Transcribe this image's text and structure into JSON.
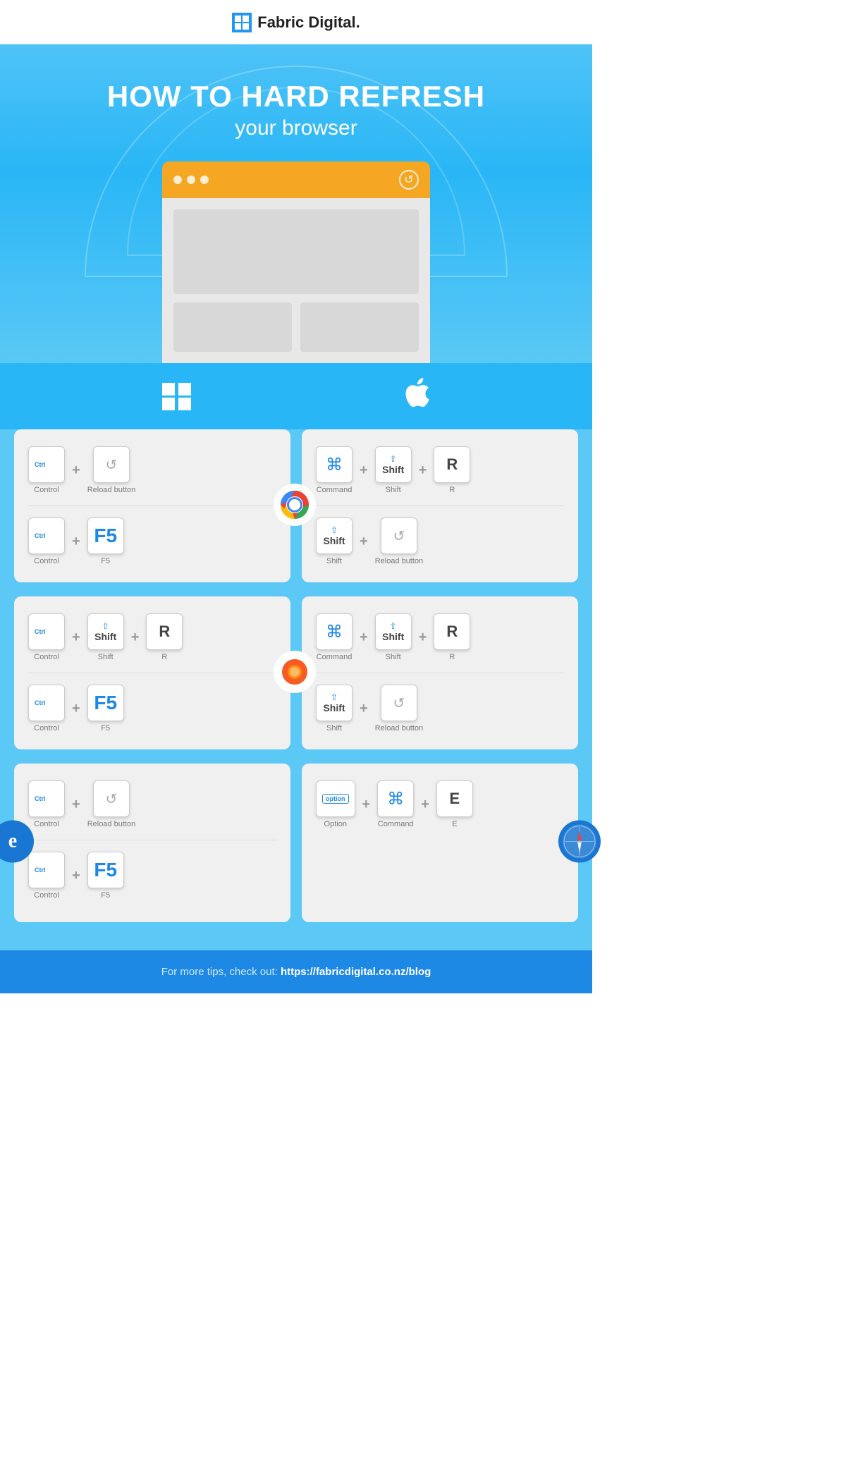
{
  "header": {
    "logo_text": "Fabric Digital.",
    "logo_icon": "F"
  },
  "hero": {
    "title": "HOW TO HARD REFRESH",
    "subtitle": "your browser"
  },
  "os": {
    "windows_label": "Windows",
    "mac_label": "Mac"
  },
  "chrome": {
    "name": "Chrome",
    "windows": {
      "row1": {
        "key1_top": "Ctrl",
        "key1_main": "",
        "key1_caption": "Control",
        "key2_icon": "↺",
        "key2_caption": "Reload button"
      },
      "row2": {
        "key1_top": "Ctrl",
        "key1_caption": "Control",
        "key2_main": "F5",
        "key2_caption": "F5"
      }
    },
    "mac": {
      "row1": {
        "key1_cmd": "⌘",
        "key1_caption": "Command",
        "key2_shift_icon": "⇧",
        "key2_main": "Shift",
        "key2_caption": "Shift",
        "key3_main": "R",
        "key3_caption": "R"
      },
      "row2": {
        "key1_shift_icon": "⇧",
        "key1_main": "Shift",
        "key1_caption": "Shift",
        "key2_icon": "↺",
        "key2_caption": "Reload button"
      }
    }
  },
  "firefox": {
    "name": "Firefox",
    "windows": {
      "row1": {
        "key1_top": "Ctrl",
        "key1_caption": "Control",
        "key2_shift_icon": "⇧",
        "key2_main": "Shift",
        "key2_caption": "Shift",
        "key3_main": "R",
        "key3_caption": "R"
      },
      "row2": {
        "key1_top": "Ctrl",
        "key1_caption": "Control",
        "key2_main": "F5",
        "key2_caption": "F5"
      }
    },
    "mac": {
      "row1": {
        "key1_cmd": "⌘",
        "key1_caption": "Command",
        "key2_shift_icon": "⇧",
        "key2_main": "Shift",
        "key2_caption": "Shift",
        "key3_main": "R",
        "key3_caption": "R"
      },
      "row2": {
        "key1_shift_icon": "⇧",
        "key1_main": "Shift",
        "key1_caption": "Shift",
        "key2_icon": "↺",
        "key2_caption": "Reload button"
      }
    }
  },
  "ie": {
    "name": "Internet Explorer",
    "windows": {
      "row1": {
        "key1_top": "Ctrl",
        "key1_caption": "Control",
        "key2_icon": "↺",
        "key2_caption": "Reload button"
      },
      "row2": {
        "key1_top": "Ctrl",
        "key1_caption": "Control",
        "key2_main": "F5",
        "key2_caption": "F5"
      }
    }
  },
  "safari": {
    "name": "Safari",
    "mac": {
      "row1": {
        "key1_option": "option",
        "key1_caption": "Option",
        "key2_cmd": "⌘",
        "key2_caption": "Command",
        "key3_main": "E",
        "key3_caption": "E"
      }
    }
  },
  "footer": {
    "text": "For more tips, check out:",
    "link_text": "https://fabricdigital.co.nz/blog",
    "link_url": "https://fabricdigital.co.nz/blog"
  }
}
